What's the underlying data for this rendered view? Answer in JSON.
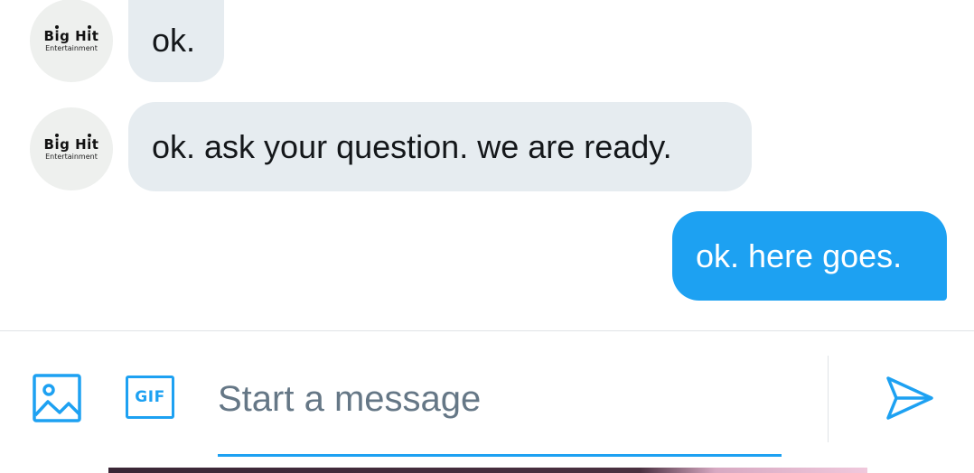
{
  "conversation": {
    "messages": [
      {
        "sender": "them",
        "avatar": {
          "logo_text": "Big Hit",
          "logo_subtext": "Entertainment"
        },
        "text": "ok."
      },
      {
        "sender": "them",
        "avatar": {
          "logo_text": "Big Hit",
          "logo_subtext": "Entertainment"
        },
        "text": "ok. ask your question. we are ready."
      },
      {
        "sender": "me",
        "text": "ok. here goes."
      }
    ]
  },
  "composer": {
    "media_icon": "image-icon",
    "gif_label": "GIF",
    "input_placeholder": "Start a message",
    "input_value": "",
    "send_icon": "send-icon"
  },
  "colors": {
    "accent": "#1da1f2",
    "received_bubble": "#e6ecf0",
    "placeholder": "#657786",
    "text": "#14171a"
  }
}
